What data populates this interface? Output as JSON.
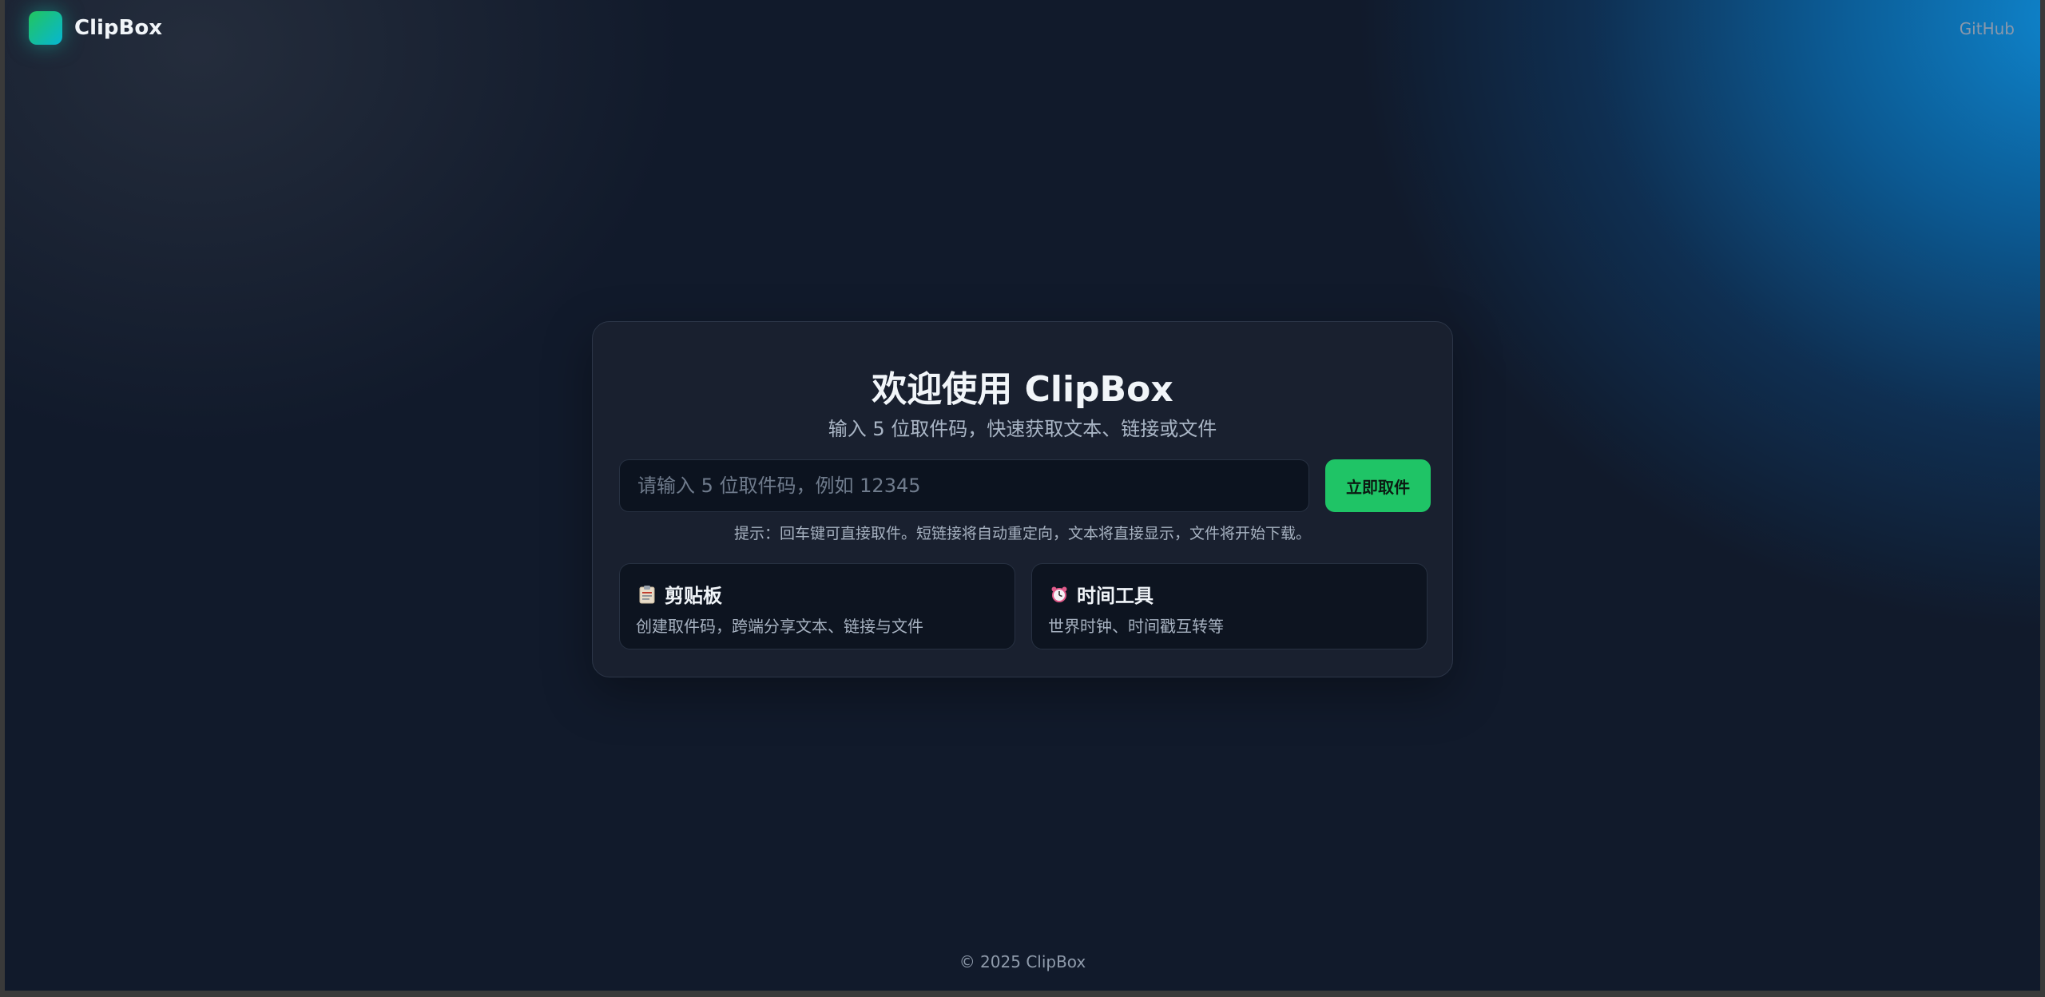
{
  "header": {
    "brand_name": "ClipBox",
    "github_label": "GitHub"
  },
  "main": {
    "title": "欢迎使用 ClipBox",
    "subtitle": "输入 5 位取件码，快速获取文本、链接或文件",
    "code_input": {
      "value": "",
      "placeholder": "请输入 5 位取件码，例如 12345"
    },
    "fetch_button_label": "立即取件",
    "hint": "提示：回车键可直接取件。短链接将自动重定向，文本将直接显示，文件将开始下载。",
    "tools": [
      {
        "icon": "clipboard-icon",
        "title": "剪贴板",
        "description": "创建取件码，跨端分享文本、链接与文件"
      },
      {
        "icon": "alarm-clock-icon",
        "title": "时间工具",
        "description": "世界时钟、时间戳互转等"
      }
    ]
  },
  "footer": {
    "copyright": "© 2025 ClipBox"
  },
  "colors": {
    "background": "#111a2b",
    "accent": "#1fc466",
    "logo_gradient_start": "#22c55e",
    "logo_gradient_end": "#06b6d4",
    "glow_blue": "#0e8bd6"
  }
}
